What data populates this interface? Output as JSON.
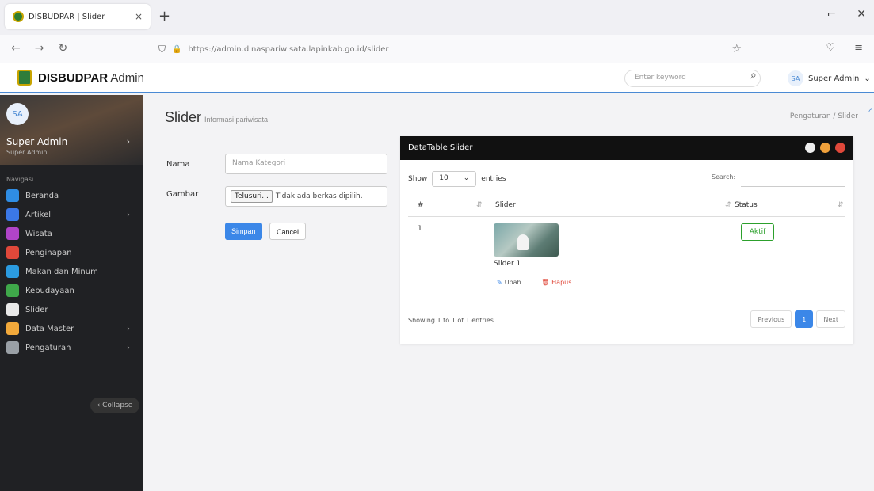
{
  "browser": {
    "tab_title": "DISBUDPAR | Slider",
    "tab_close": "×",
    "new_tab": "+",
    "url": "https://admin.dinaspariwisata.lapinkab.go.id/slider",
    "lock": "🔒",
    "star": "☆"
  },
  "app": {
    "brand_bold": "DISBUDPAR",
    "brand_rest": " Admin",
    "search_placeholder": "Enter keyword",
    "user_initials": "SA",
    "user_name": "Super Admin",
    "user_caret": "⌄"
  },
  "sidebar": {
    "avatar": "SA",
    "user_name": "Super Admin",
    "user_role": "Super Admin",
    "chevron": "›",
    "section": "Navigasi",
    "items": [
      {
        "label": "Beranda",
        "color": "#2f8de4",
        "arrow": ""
      },
      {
        "label": "Artikel",
        "color": "#3b78e7",
        "arrow": "›"
      },
      {
        "label": "Wisata",
        "color": "#b044c8",
        "arrow": ""
      },
      {
        "label": "Penginapan",
        "color": "#e0483a",
        "arrow": ""
      },
      {
        "label": "Makan dan Minum",
        "color": "#2b9be0",
        "arrow": ""
      },
      {
        "label": "Kebudayaan",
        "color": "#3fa84a",
        "arrow": ""
      },
      {
        "label": "Slider",
        "color": "#e8e8e8",
        "arrow": ""
      },
      {
        "label": "Data Master",
        "color": "#f2a93b",
        "arrow": "›"
      },
      {
        "label": "Pengaturan",
        "color": "#9aa0a6",
        "arrow": "›"
      }
    ],
    "collapse": "‹ Collapse"
  },
  "page": {
    "title": "Slider",
    "subtitle": "Informasi pariwisata",
    "breadcrumb": "Pengaturan / Slider"
  },
  "form": {
    "name_label": "Nama",
    "name_placeholder": "Nama Kategori",
    "image_label": "Gambar",
    "file_button": "Telusuri...",
    "file_status": "Tidak ada berkas dipilih.",
    "save": "Simpan",
    "cancel": "Cancel"
  },
  "table": {
    "header": "DataTable Slider",
    "show": "Show",
    "entries_value": "10",
    "entries": "entries",
    "search_label": "Search:",
    "col_no": "#",
    "col_slider": "Slider",
    "col_status": "Status",
    "rows": [
      {
        "no": "1",
        "name": "Slider 1",
        "edit": "Ubah",
        "delete": "Hapus",
        "status": "Aktif"
      }
    ],
    "footer": "Showing 1 to 1 of 1 entries",
    "prev": "Previous",
    "page": "1",
    "next": "Next"
  },
  "colors": {
    "accent": "#3b87e8",
    "success": "#2ca02c",
    "danger": "#e0483a",
    "header_dark": "#111111"
  }
}
